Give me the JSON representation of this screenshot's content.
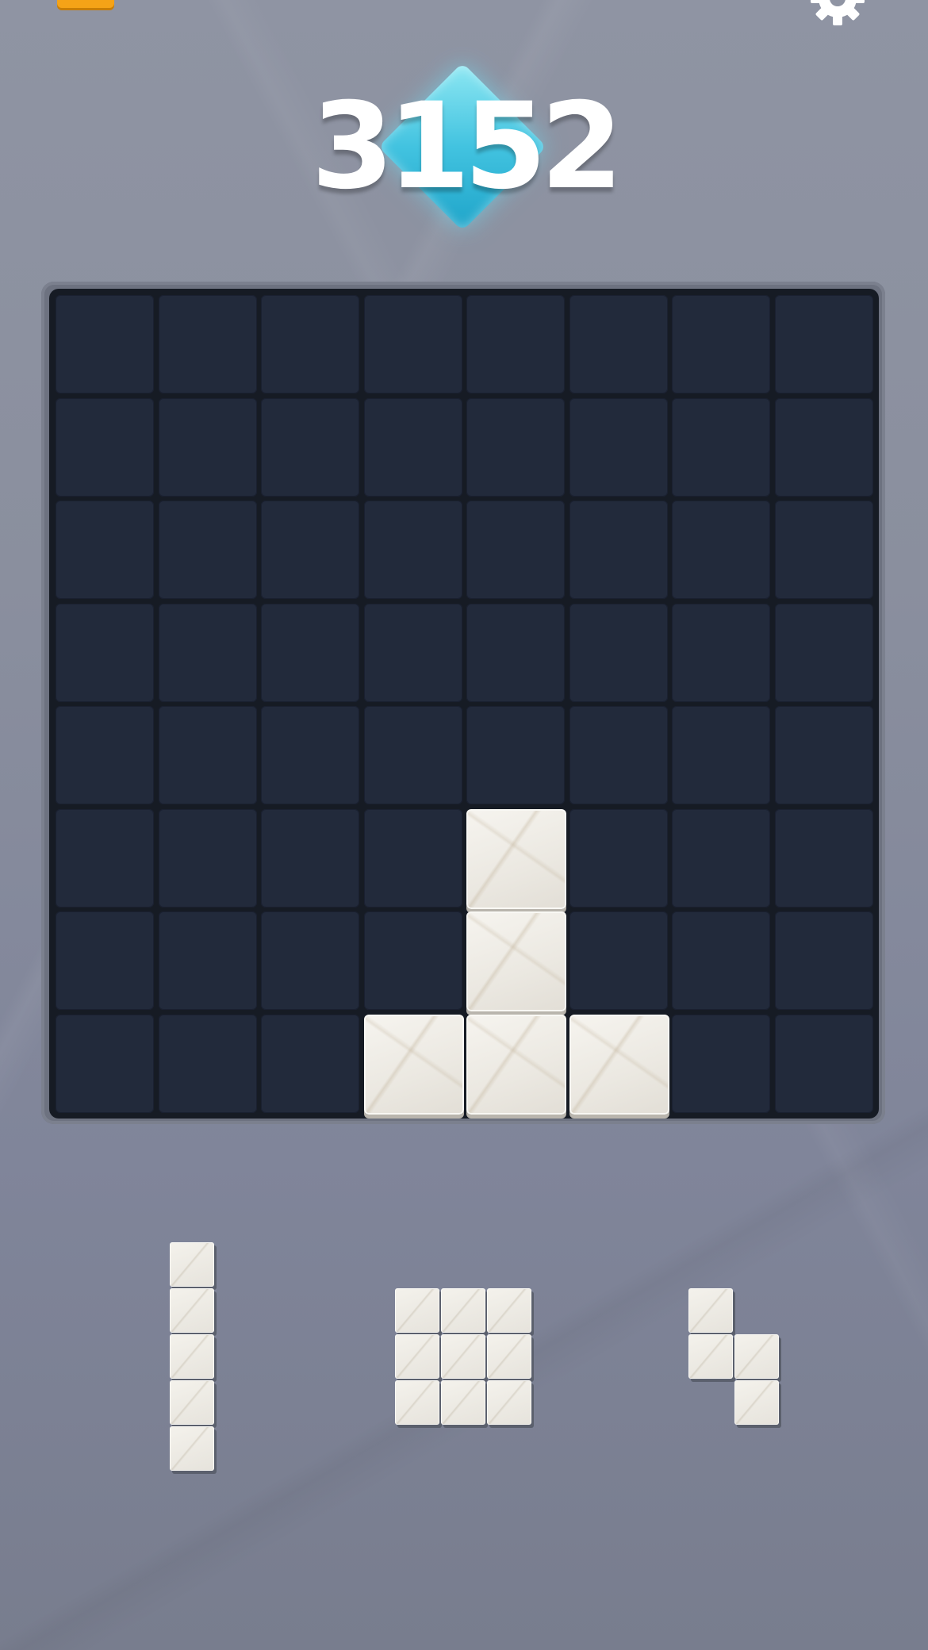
{
  "score": {
    "value": "3152"
  },
  "colors": {
    "background": "#8a8f9e",
    "board": "#161b24",
    "empty_cell": "#222a3b",
    "block": "#ebe8e1",
    "score_diamond": "#42c3e0",
    "menu_button": "#f5a317"
  },
  "icons": {
    "menu": "menu-icon",
    "settings": "gear-icon",
    "score_badge": "diamond-icon"
  },
  "board": {
    "rows": 8,
    "cols": 8,
    "filled_cells": [
      [
        5,
        4
      ],
      [
        6,
        4
      ],
      [
        7,
        3
      ],
      [
        7,
        4
      ],
      [
        7,
        5
      ]
    ]
  },
  "tray": {
    "pieces": [
      {
        "id": "piece-vertical-5",
        "cells": [
          [
            0,
            0
          ],
          [
            1,
            0
          ],
          [
            2,
            0
          ],
          [
            3,
            0
          ],
          [
            4,
            0
          ]
        ]
      },
      {
        "id": "piece-square-3x3",
        "cells": [
          [
            0,
            0
          ],
          [
            0,
            1
          ],
          [
            0,
            2
          ],
          [
            1,
            0
          ],
          [
            1,
            1
          ],
          [
            1,
            2
          ],
          [
            2,
            0
          ],
          [
            2,
            1
          ],
          [
            2,
            2
          ]
        ]
      },
      {
        "id": "piece-s-shape",
        "cells": [
          [
            0,
            0
          ],
          [
            1,
            0
          ],
          [
            1,
            1
          ],
          [
            2,
            1
          ]
        ]
      }
    ]
  }
}
